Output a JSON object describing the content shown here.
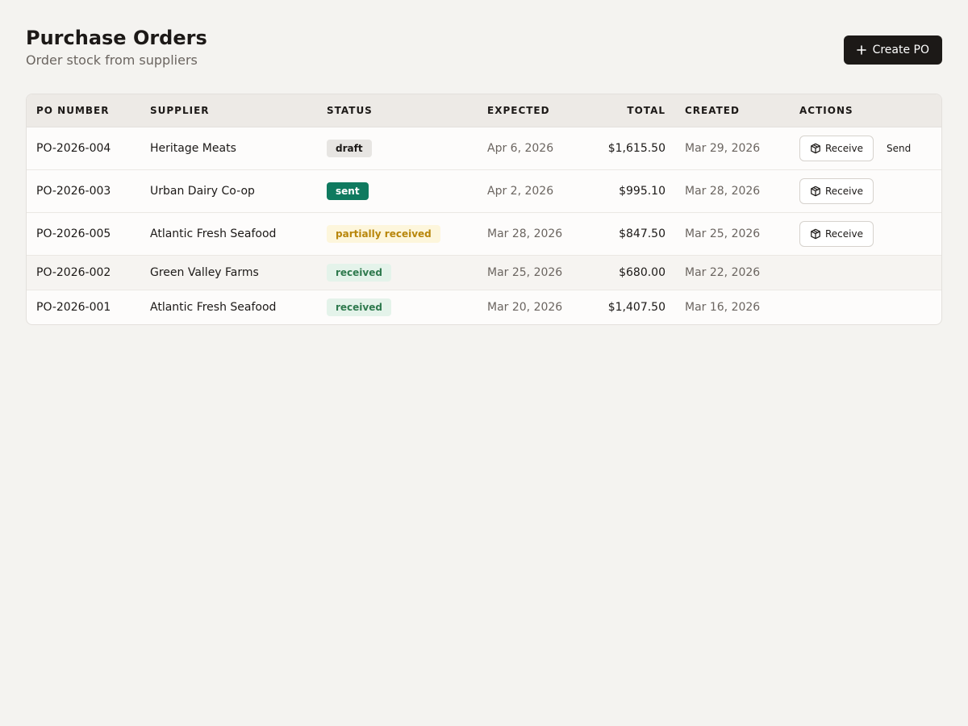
{
  "header": {
    "title": "Purchase Orders",
    "subtitle": "Order stock from suppliers",
    "create_label": "Create PO",
    "create_icon": "plus-icon"
  },
  "table": {
    "columns": [
      "PO NUMBER",
      "SUPPLIER",
      "STATUS",
      "EXPECTED",
      "TOTAL",
      "CREATED",
      "ACTIONS"
    ],
    "rows": [
      {
        "po": "PO-2026-004",
        "supplier": "Heritage Meats",
        "status": "draft",
        "expected": "Apr 6, 2026",
        "total": "$1,615.50",
        "created": "Mar 29, 2026",
        "actions": [
          "Receive",
          "Send"
        ]
      },
      {
        "po": "PO-2026-003",
        "supplier": "Urban Dairy Co-op",
        "status": "sent",
        "expected": "Apr 2, 2026",
        "total": "$995.10",
        "created": "Mar 28, 2026",
        "actions": [
          "Receive"
        ]
      },
      {
        "po": "PO-2026-005",
        "supplier": "Atlantic Fresh Seafood",
        "status": "partially received",
        "expected": "Mar 28, 2026",
        "total": "$847.50",
        "created": "Mar 25, 2026",
        "actions": [
          "Receive"
        ]
      },
      {
        "po": "PO-2026-002",
        "supplier": "Green Valley Farms",
        "status": "received",
        "expected": "Mar 25, 2026",
        "total": "$680.00",
        "created": "Mar 22, 2026",
        "actions": []
      },
      {
        "po": "PO-2026-001",
        "supplier": "Atlantic Fresh Seafood",
        "status": "received",
        "expected": "Mar 20, 2026",
        "total": "$1,407.50",
        "created": "Mar 16, 2026",
        "actions": []
      }
    ]
  },
  "status_colors": {
    "draft": {
      "bg": "#e7e5e2",
      "fg": "#1c1917"
    },
    "sent": {
      "bg": "#0f7a5f",
      "fg": "#ffffff"
    },
    "partially received": {
      "bg": "#fdf6dc",
      "fg": "#b8860b"
    },
    "received": {
      "bg": "#e4f3ea",
      "fg": "#2f7a4e"
    }
  },
  "icons": {
    "receive": "package-icon"
  }
}
